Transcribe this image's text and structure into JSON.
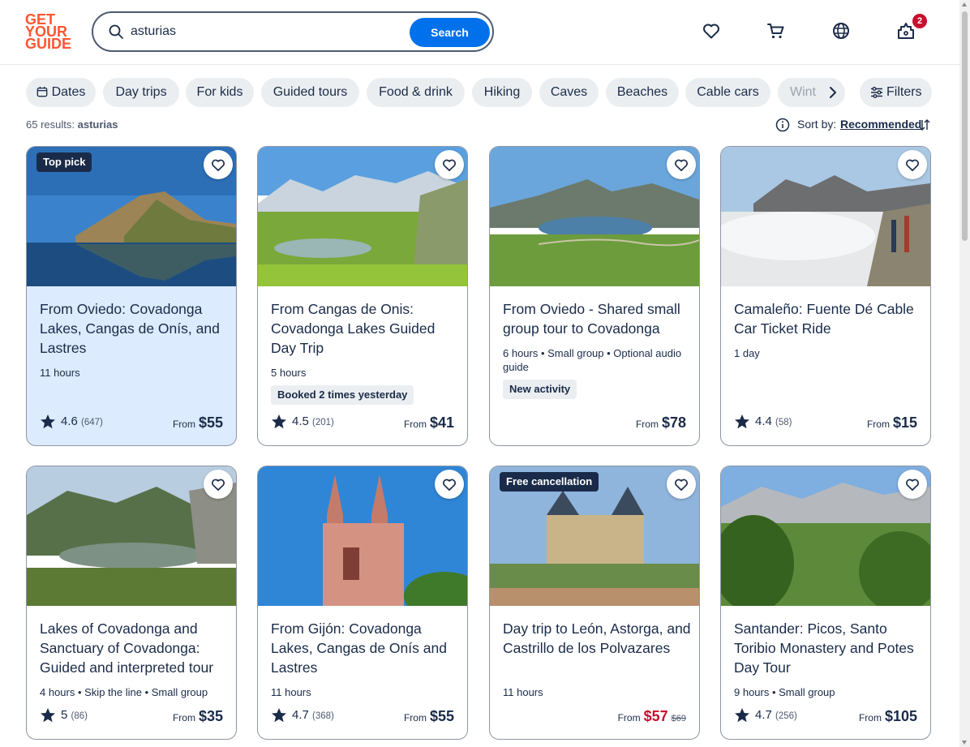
{
  "logo": {
    "lines": [
      "GET",
      "YOUR",
      "GUIDE"
    ],
    "color": "#ff5533"
  },
  "search": {
    "value": "asturias",
    "button_label": "Search"
  },
  "header": {
    "cart_badge": "2"
  },
  "chips": [
    {
      "label": "Dates",
      "icon": "calendar-icon"
    },
    {
      "label": "Day trips"
    },
    {
      "label": "For kids"
    },
    {
      "label": "Guided tours"
    },
    {
      "label": "Food & drink"
    },
    {
      "label": "Hiking"
    },
    {
      "label": "Caves"
    },
    {
      "label": "Beaches"
    },
    {
      "label": "Cable cars"
    },
    {
      "label": "Wint"
    }
  ],
  "filters_label": "Filters",
  "results": {
    "count": "65 results:",
    "query": "asturias"
  },
  "sort": {
    "label": "Sort by:",
    "value": "Recommended"
  },
  "colors": {
    "accent": "#0071eb",
    "text": "#1a2b49",
    "sale": "#c8102e",
    "highlight": "#dcebfd"
  },
  "cards": [
    {
      "badge": "Top pick",
      "title": "From Oviedo: Covadonga Lakes, Cangas de Onís, and Lastres",
      "meta": "11 hours",
      "rating": "4.6",
      "reviews": "(647)",
      "from": "From",
      "price": "$55"
    },
    {
      "title": "From Cangas de Onis: Covadonga Lakes Guided Day Trip",
      "meta": "5 hours",
      "pill": "Booked 2 times yesterday",
      "rating": "4.5",
      "reviews": "(201)",
      "from": "From",
      "price": "$41"
    },
    {
      "title": "From Oviedo - Shared small group tour to Covadonga",
      "meta": "6 hours • Small group • Optional audio guide",
      "pill": "New activity",
      "from": "From",
      "price": "$78"
    },
    {
      "title": "Camaleño: Fuente Dé Cable Car Ticket Ride",
      "meta": "1 day",
      "rating": "4.4",
      "reviews": "(58)",
      "from": "From",
      "price": "$15"
    },
    {
      "title": "Lakes of Covadonga and Sanctuary of Covadonga: Guided and interpreted tour",
      "meta": "4 hours • Skip the line • Small group",
      "rating": "5",
      "reviews": "(86)",
      "from": "From",
      "price": "$35"
    },
    {
      "title": "From Gijón: Covadonga Lakes, Cangas de Onís and Lastres",
      "meta": "11 hours",
      "rating": "4.7",
      "reviews": "(368)",
      "from": "From",
      "price": "$55"
    },
    {
      "badge": "Free cancellation",
      "title": "Day trip to León, Astorga, and Castrillo de los Polvazares",
      "meta": "11 hours",
      "from": "From",
      "price": "$57",
      "old_price": "$69"
    },
    {
      "title": "Santander: Picos, Santo Toribio Monastery and Potes Day Tour",
      "meta": "9 hours • Small group",
      "rating": "4.7",
      "reviews": "(256)",
      "from": "From",
      "price": "$105"
    }
  ]
}
